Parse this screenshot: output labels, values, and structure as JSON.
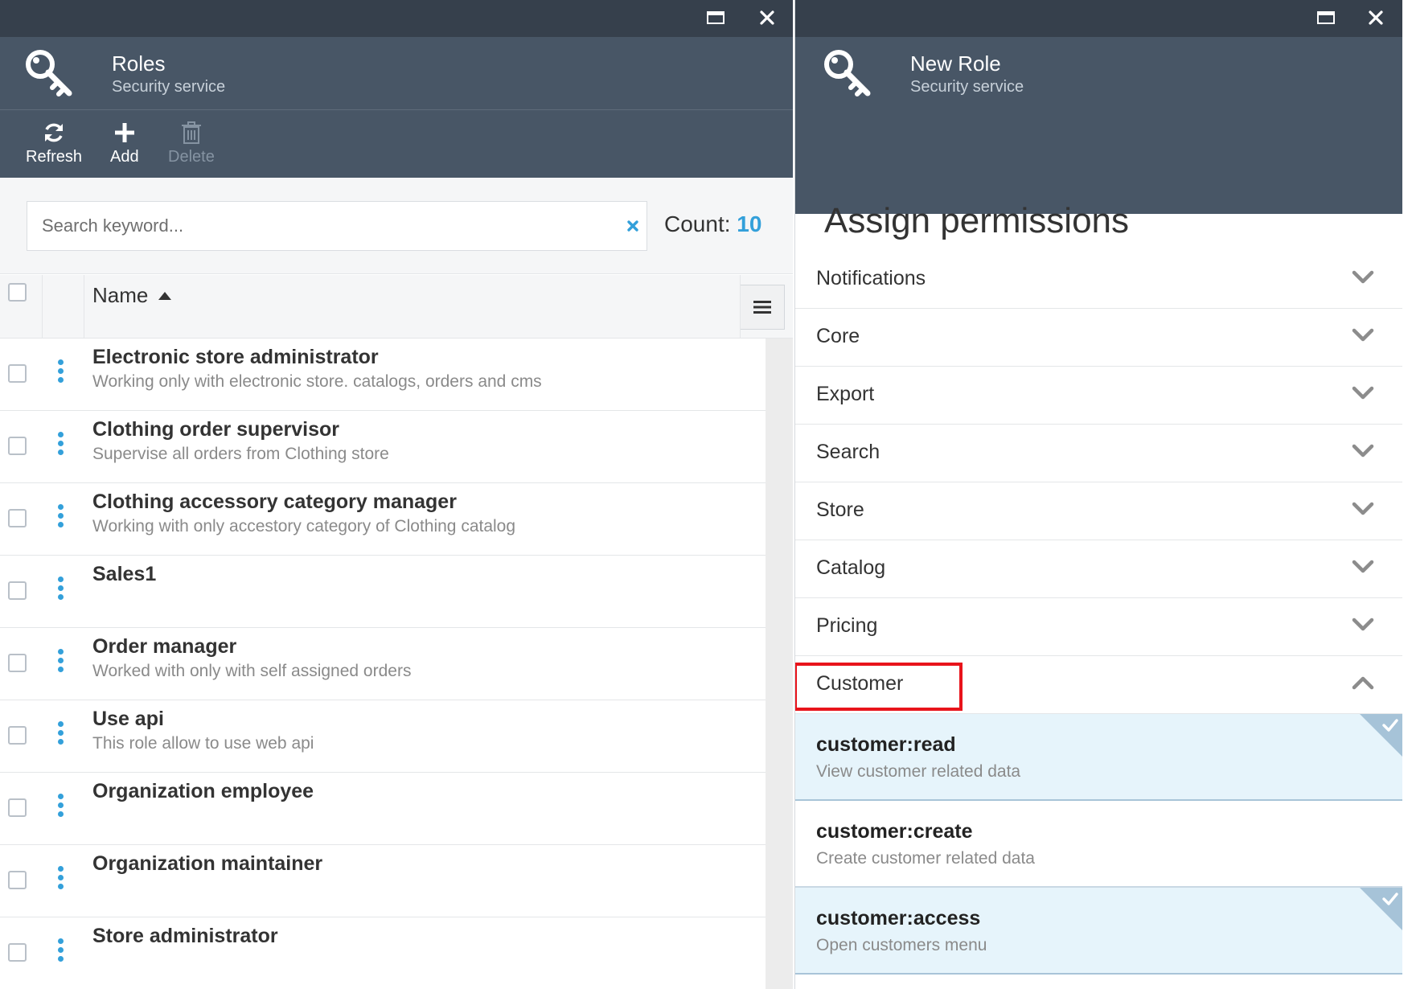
{
  "roles_blade": {
    "title": "Roles",
    "subtitle": "Security service",
    "toolbar": {
      "refresh_label": "Refresh",
      "add_label": "Add",
      "delete_label": "Delete"
    },
    "search": {
      "placeholder": "Search keyword...",
      "value": ""
    },
    "count_label": "Count:",
    "count_value": "10",
    "grid": {
      "name_header": "Name",
      "sort": "ascending",
      "rows": [
        {
          "name": "Electronic store administrator",
          "description": "Working only with electronic store. catalogs, orders and cms"
        },
        {
          "name": "Clothing order supervisor",
          "description": "Supervise all orders from Clothing store"
        },
        {
          "name": "Clothing accessory category manager",
          "description": "Working with only accestory category of Clothing catalog"
        },
        {
          "name": "Sales1",
          "description": ""
        },
        {
          "name": "Order manager",
          "description": "Worked with only with self assigned orders"
        },
        {
          "name": "Use api",
          "description": "This role allow to use web api"
        },
        {
          "name": "Organization employee",
          "description": ""
        },
        {
          "name": "Organization maintainer",
          "description": ""
        },
        {
          "name": "Store administrator",
          "description": ""
        }
      ]
    }
  },
  "new_role_blade": {
    "title": "New Role",
    "subtitle": "Security service",
    "heading": "Assign permissions",
    "sections": [
      {
        "label": "Notifications",
        "expanded": false
      },
      {
        "label": "Core",
        "expanded": false
      },
      {
        "label": "Export",
        "expanded": false
      },
      {
        "label": "Search",
        "expanded": false
      },
      {
        "label": "Store",
        "expanded": false
      },
      {
        "label": "Catalog",
        "expanded": false
      },
      {
        "label": "Pricing",
        "expanded": false
      },
      {
        "label": "Customer",
        "expanded": true,
        "highlighted": true
      }
    ],
    "permissions": [
      {
        "name": "customer:read",
        "description": "View customer related data",
        "selected": true
      },
      {
        "name": "customer:create",
        "description": "Create customer related data",
        "selected": false
      },
      {
        "name": "customer:access",
        "description": "Open customers menu",
        "selected": true
      }
    ]
  },
  "colors": {
    "header_dark": "#36404c",
    "header": "#485666",
    "accent": "#33a0da",
    "highlight_box": "#e8141b",
    "selected_row": "#e6f4fb"
  }
}
